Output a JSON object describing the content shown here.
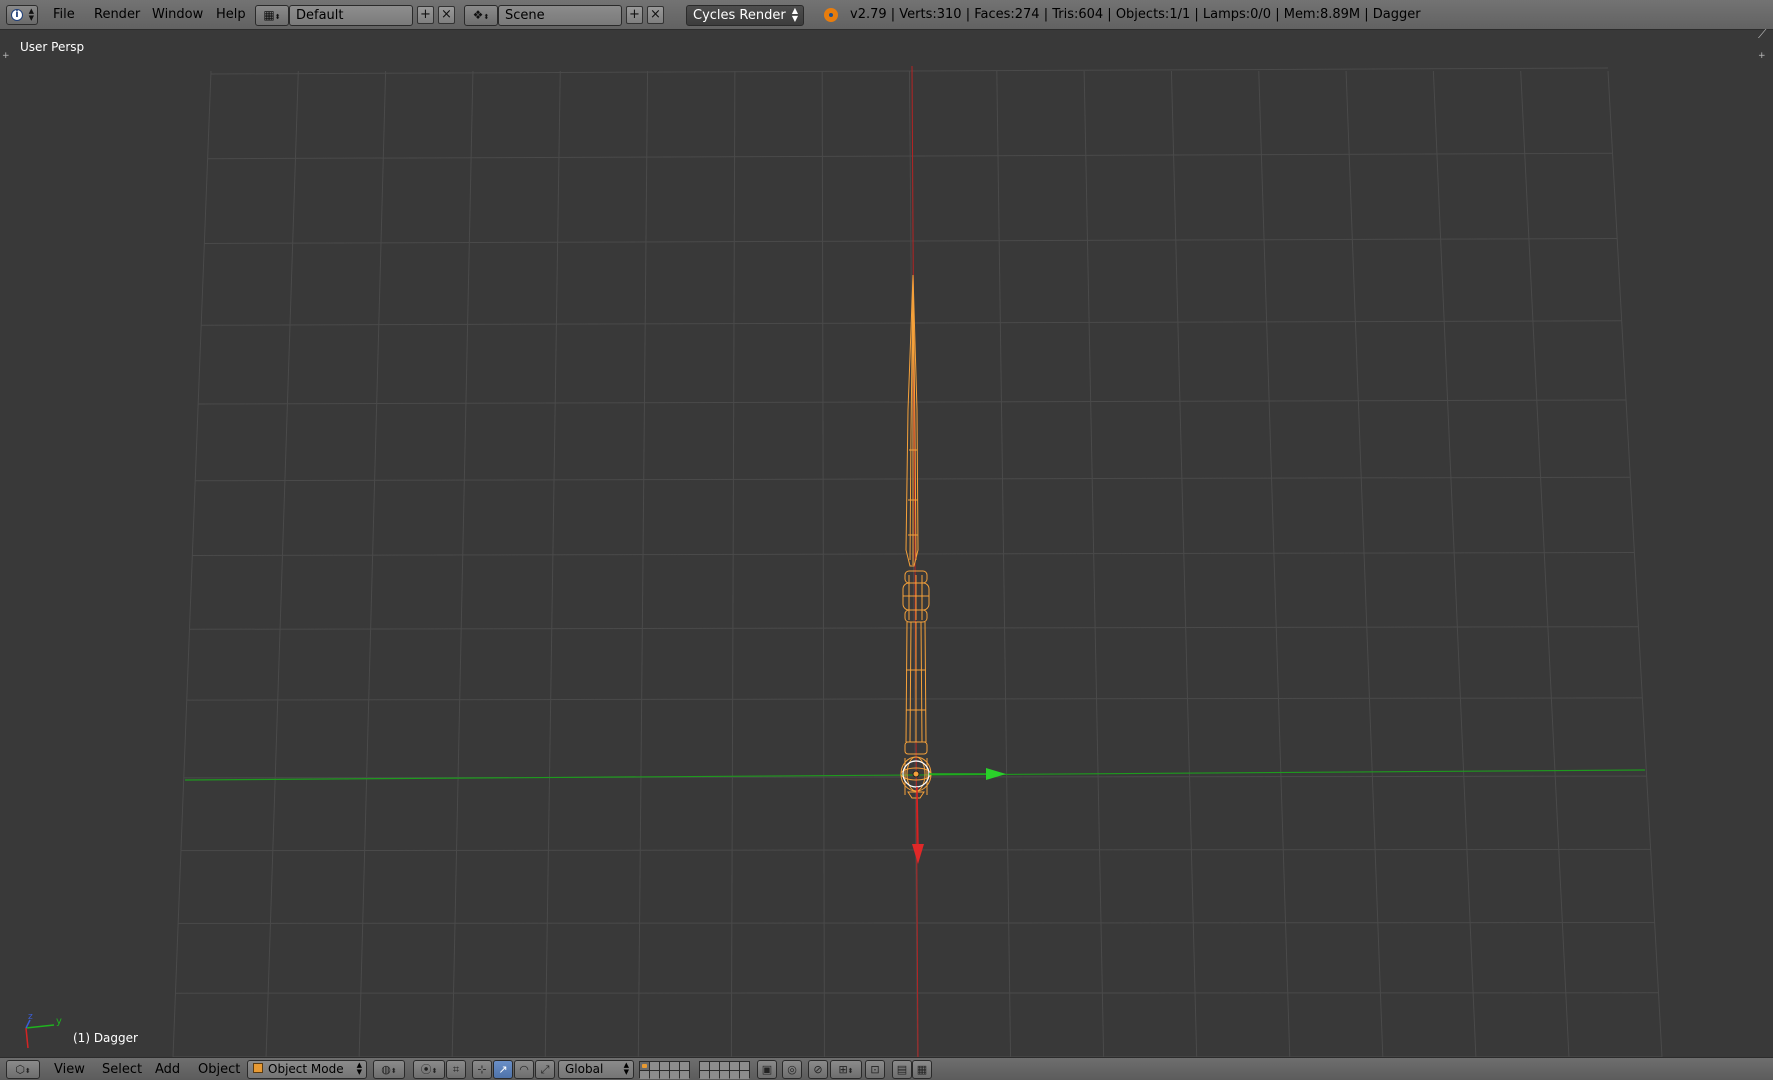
{
  "topbar": {
    "editor_icon": "info-icon",
    "menus": [
      "File",
      "Render",
      "Window",
      "Help"
    ],
    "layout_icon": "screen-layout-icon",
    "screen_layout": "Default",
    "scene_icon": "scene-icon",
    "scene": "Scene",
    "add_icon": "+",
    "remove_icon": "×",
    "render_engine": "Cycles Render",
    "stats": "v2.79 | Verts:310 | Faces:274 | Tris:604 | Objects:1/1 | Lamps:0/0 | Mem:8.89M | Dagger"
  },
  "viewport": {
    "view_label": "User Persp",
    "object_label": "(1) Dagger",
    "axis_y_label": "y",
    "axis_z_label": "z"
  },
  "bottombar": {
    "editor_icon": "3d-view-icon",
    "menus": [
      "View",
      "Select",
      "Add",
      "Object"
    ],
    "mode": "Object Mode",
    "shading_icon": "viewport-shading-icon",
    "pivot_icon": "pivot-point-icon",
    "orientation": "Global",
    "layers_active": [
      0
    ]
  },
  "colors": {
    "viewport_bg": "#393939",
    "grid": "#4a4a4a",
    "x_axis": "#c02020",
    "y_axis": "#1fa01f",
    "selected_object": "#f5a13a"
  }
}
